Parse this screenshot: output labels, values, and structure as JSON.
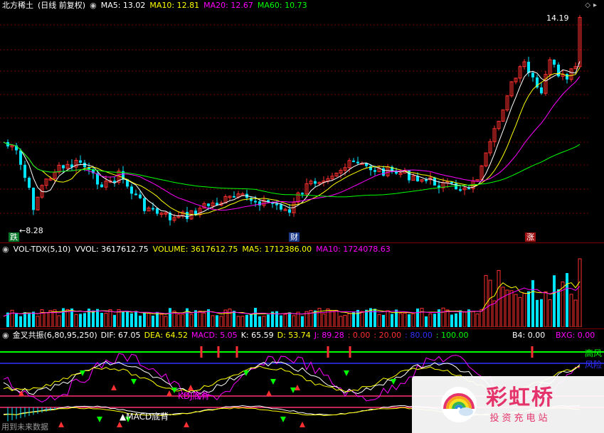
{
  "main_header": {
    "title": "北方稀土",
    "period": "(日线 前复权)",
    "ma": [
      {
        "label": "MA5: 13.02",
        "color": "#ffffff"
      },
      {
        "label": "MA10: 12.81",
        "color": "#ffff00"
      },
      {
        "label": "MA20: 12.67",
        "color": "#ff00ff"
      },
      {
        "label": "MA60: 10.73",
        "color": "#00ff00"
      }
    ]
  },
  "price_labels": {
    "high": "14.19",
    "low": "8.28"
  },
  "markers": {
    "die": "跌",
    "cai": "财",
    "zhang": "涨"
  },
  "volume_header": {
    "name": "VOL-TDX(5,10)",
    "vvol": "VVOL: 3617612.75",
    "volume": "VOLUME: 3617612.75",
    "ma5": "MA5: 1712386.00",
    "ma10": "MA10: 1724078.63"
  },
  "indicator_header": {
    "name": "金叉共振(6,80,95,250)",
    "items": [
      {
        "label": "DIF: 67.05",
        "color": "#ffffff"
      },
      {
        "label": "DEA: 64.52",
        "color": "#ffff00"
      },
      {
        "label": "MACD: 5.05",
        "color": "#ff00ff"
      },
      {
        "label": "K: 65.59",
        "color": "#ffffff"
      },
      {
        "label": "D: 53.74",
        "color": "#ffff00"
      },
      {
        "label": "J: 89.28",
        "color": "#ff00ff"
      },
      {
        "label": ": 0.00",
        "color": "#ff3030"
      },
      {
        "label": ": 20.00",
        "color": "#ff3030"
      },
      {
        "label": ": 80.00",
        "color": "#3030ff"
      },
      {
        "label": ": 100.00",
        "color": "#00ff00"
      }
    ],
    "b4": "B4: 0.00",
    "bxg": "BXG: 0.00"
  },
  "indicator_labels": {
    "gaofeng": "高风",
    "fengxian": "风险",
    "kdj": "KDJ底背",
    "macd": "▲MACD底背"
  },
  "footer": "用到未来数据",
  "watermark": {
    "title": "彩虹桥",
    "subtitle": "投资充电站"
  },
  "colors": {
    "up": "#ff3030",
    "up_body": "#00e5ff",
    "down": "#00e5ff",
    "ma5": "#ffffff",
    "ma10": "#ffff00",
    "ma20": "#ff00ff",
    "ma60": "#00ff00"
  }
}
